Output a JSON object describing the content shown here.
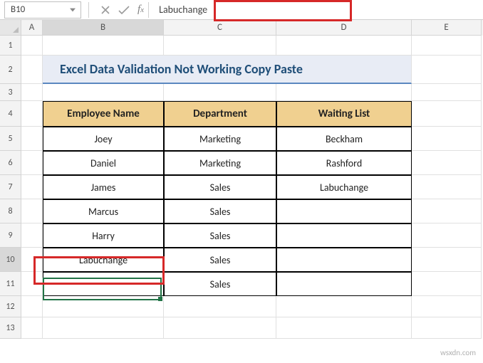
{
  "nameBox": {
    "ref": "B10"
  },
  "formulaBar": {
    "value": "Labuchange"
  },
  "columns": [
    "A",
    "B",
    "C",
    "D",
    "E"
  ],
  "selectedColumn": "B",
  "rows": [
    1,
    2,
    3,
    4,
    5,
    6,
    7,
    8,
    9,
    10,
    11,
    12,
    13
  ],
  "selectedRow": 10,
  "title": "Excel Data Validation Not Working Copy Paste",
  "table": {
    "headers": {
      "b": "Employee Name",
      "c": "Department",
      "d": "Waiting List"
    },
    "rows": [
      {
        "b": "Joey",
        "c": "Marketing",
        "d": "Beckham"
      },
      {
        "b": "Daniel",
        "c": "Marketing",
        "d": "Rashford"
      },
      {
        "b": "James",
        "c": "Sales",
        "d": "Labuchange"
      },
      {
        "b": "Marcus",
        "c": "Sales",
        "d": ""
      },
      {
        "b": "Harry",
        "c": "Sales",
        "d": ""
      },
      {
        "b": "Labuchange",
        "c": "Sales",
        "d": ""
      },
      {
        "b": "",
        "c": "Sales",
        "d": ""
      }
    ]
  },
  "watermark": "wsxdn.com"
}
